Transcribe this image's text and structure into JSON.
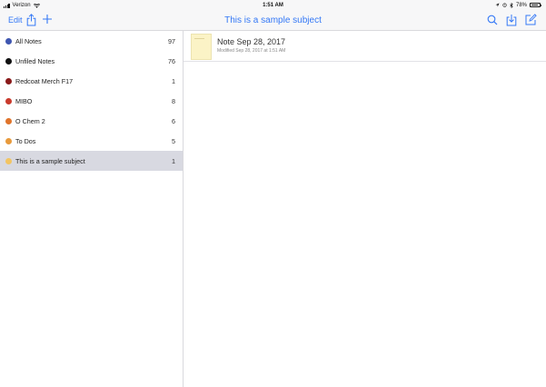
{
  "status_bar": {
    "carrier": "Verizon",
    "time": "1:51 AM",
    "battery": "78%",
    "battery_level": 0.78
  },
  "nav": {
    "edit_label": "Edit",
    "title": "This is a sample subject",
    "icons": [
      "share-icon",
      "add-icon",
      "search-icon",
      "download-icon",
      "compose-icon"
    ],
    "accent_color": "#3478f6"
  },
  "sidebar": {
    "items": [
      {
        "label": "All Notes",
        "count": "97",
        "color": "#3f56b0",
        "selected": false
      },
      {
        "label": "Unfiled Notes",
        "count": "76",
        "color": "#111111",
        "selected": false
      },
      {
        "label": "Redcoat Merch F17",
        "count": "1",
        "color": "#8a1a1a",
        "selected": false
      },
      {
        "label": "MIBO",
        "count": "8",
        "color": "#c93a2c",
        "selected": false
      },
      {
        "label": "O Chem 2",
        "count": "6",
        "color": "#e0742b",
        "selected": false
      },
      {
        "label": "To Dos",
        "count": "5",
        "color": "#e89a3c",
        "selected": false
      },
      {
        "label": "This is a sample subject",
        "count": "1",
        "color": "#f2c462",
        "selected": true
      }
    ],
    "selected_bg": "#d8d9e1"
  },
  "notes": [
    {
      "title": "Note Sep 28, 2017",
      "modified": "Modified Sep 28, 2017 at 1:51 AM"
    }
  ]
}
